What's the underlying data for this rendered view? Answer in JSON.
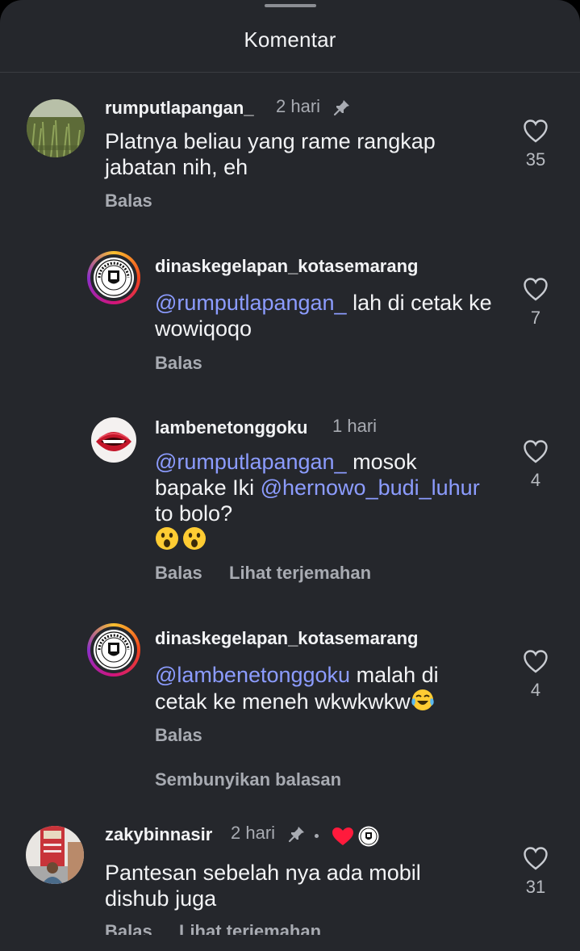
{
  "sheet": {
    "title": "Komentar"
  },
  "comments": [
    {
      "username": "rumputlapangan_",
      "time": "2 hari",
      "text": "Platnya beliau yang rame rangkap jabatan nih, eh",
      "actions": [
        "Balas"
      ],
      "likes": "35"
    },
    {
      "username": "dinaskegelapan_kotasemarang",
      "mention": "@rumputlapangan_",
      "text": " lah di cetak ke wowiqoqo",
      "actions": [
        "Balas"
      ],
      "likes": "7"
    },
    {
      "username": "lambenetonggoku",
      "time": "1 hari",
      "mention": "@rumputlapangan_",
      "text_a": " mosok bapake Iki ",
      "mention2": "@hernowo_budi_luhur",
      "text_b": " to bolo?",
      "actions": [
        "Balas",
        "Lihat terjemahan"
      ],
      "likes": "4"
    },
    {
      "username": "dinaskegelapan_kotasemarang",
      "mention": "@lambenetonggoku",
      "text": " malah di cetak ke meneh wkwkwkw",
      "actions": [
        "Balas"
      ],
      "likes": "4"
    },
    {
      "username": "zakybinnasir",
      "time": "2 hari",
      "text": "Pantesan sebelah nya ada mobil dishub juga",
      "actions": [
        "Balas",
        "Lihat terjemahan"
      ],
      "likes": "31"
    }
  ],
  "hide_replies": "Sembunyikan balasan",
  "icons": {
    "like": "heart-outline-icon",
    "pin": "pin-icon",
    "creator_heart": "heart-filled-icon",
    "surprised_emoji": "astonished-face-emoji",
    "laughing_emoji": "tears-of-joy-emoji"
  },
  "colors": {
    "background": "#25272c",
    "mention": "#8c9cff",
    "muted": "#a8abb2",
    "heart": "#ff1a3c"
  }
}
